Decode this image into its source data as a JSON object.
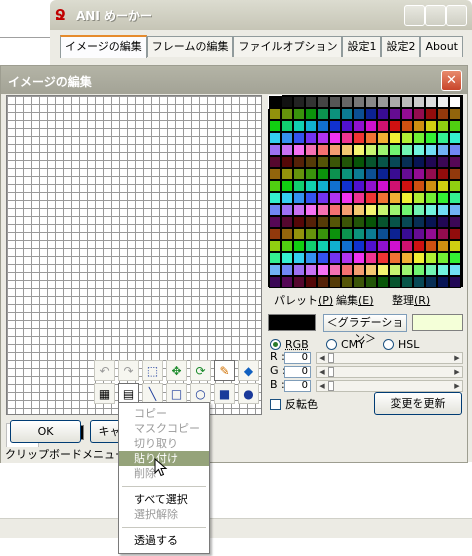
{
  "main_window": {
    "title": "ANI めーかー",
    "tabs": [
      {
        "label": "イメージの編集",
        "selected": true
      },
      {
        "label": "フレームの編集",
        "selected": false
      },
      {
        "label": "ファイルオプション",
        "selected": false
      },
      {
        "label": "設定1",
        "selected": false
      },
      {
        "label": "設定2",
        "selected": false
      },
      {
        "label": "About",
        "selected": false
      }
    ]
  },
  "dialog": {
    "title": "イメージの編集",
    "close_glyph": "✕",
    "palette_menu": {
      "palette": {
        "text": "パレット",
        "key": "(P)"
      },
      "edit": {
        "text": "編集",
        "key": "(E)"
      },
      "arrange": {
        "text": "整理",
        "key": "(R)"
      }
    },
    "gradient_button": "＜グラデーション＞",
    "color_modes": [
      {
        "label": "RGB",
        "selected": true
      },
      {
        "label": "CMY",
        "selected": false
      },
      {
        "label": "HSL",
        "selected": false
      }
    ],
    "channels": [
      {
        "label": "R :",
        "value": "0"
      },
      {
        "label": "G :",
        "value": "0"
      },
      {
        "label": "B :",
        "value": "0"
      }
    ],
    "invert_label": "反転色",
    "update_button": "変更を更新",
    "ok_button": "OK",
    "cancel_button": "キャ",
    "status_text": "クリップボードメニュー",
    "colors": {
      "accent_tab": "#e68b2c",
      "selected_foreground": "#000000",
      "selected_background": "#f4ffd8"
    }
  },
  "tools": [
    {
      "name": "undo-icon",
      "glyph": "↶"
    },
    {
      "name": "redo-icon",
      "glyph": "↷"
    },
    {
      "name": "select-rect-icon",
      "glyph": "⬚"
    },
    {
      "name": "move-icon",
      "glyph": "✥"
    },
    {
      "name": "rotate-icon",
      "glyph": "⟳"
    },
    {
      "name": "pencil-icon",
      "glyph": "✎"
    },
    {
      "name": "fill-icon",
      "glyph": "◆"
    },
    {
      "name": "grid-toggle-icon",
      "glyph": "▦"
    },
    {
      "name": "clipboard-icon",
      "glyph": "▤"
    },
    {
      "name": "line-icon",
      "glyph": "╲"
    },
    {
      "name": "rectangle-icon",
      "glyph": "□"
    },
    {
      "name": "ellipse-icon",
      "glyph": "○"
    },
    {
      "name": "filled-rectangle-icon",
      "glyph": "■"
    },
    {
      "name": "filled-ellipse-icon",
      "glyph": "●"
    }
  ],
  "context_menu": {
    "copy": {
      "label": "コピー",
      "enabled": false
    },
    "mask_copy": {
      "label": "マスクコピー",
      "enabled": false
    },
    "cut": {
      "label": "切り取り",
      "enabled": false
    },
    "paste": {
      "label": "貼り付け",
      "enabled": true,
      "highlighted": true
    },
    "delete": {
      "label": "削除",
      "enabled": false
    },
    "select_all": {
      "label": "すべて選択",
      "enabled": true
    },
    "deselect": {
      "label": "選択解除",
      "enabled": false
    },
    "transparent": {
      "label": "透過する",
      "enabled": true
    }
  }
}
